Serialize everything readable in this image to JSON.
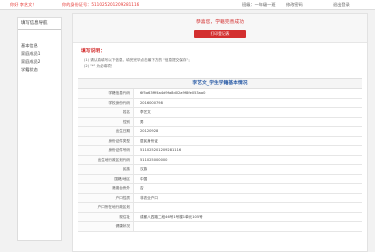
{
  "header": {
    "greeting": "你好 李艺文！",
    "id_label": "你的身份证号：",
    "id_number": "511025201209281116",
    "class_label": "班级：",
    "class_value": "一年级一班",
    "change_password": "修改密码",
    "logout": "退出登录"
  },
  "sidebar": {
    "title": "填写信息导航",
    "items": [
      {
        "label": "基本信息"
      },
      {
        "label": "家庭成员1"
      },
      {
        "label": "家庭成员2"
      },
      {
        "label": "学籍状态"
      }
    ]
  },
  "main": {
    "saved_message": "恭喜您，学籍完善成功",
    "print_button": "打印登记表",
    "notes_title": "填写说明：",
    "notes": [
      "(1) 请认真填写以下信息，填完完毕点击最下方的 \"信息提交保存\"；",
      "(2) \"*\" 为必填项！"
    ],
    "note_required_mark": "*",
    "table_title": "李艺文_学生学籍基本情况",
    "rows": [
      {
        "label": "学籍信息代码",
        "value": "6f5a63fff4a4d9fa8d02a9f8fe053aa0"
      },
      {
        "label": "学校身份代码",
        "value": "2016000798"
      },
      {
        "label": "姓名",
        "value": "李艺文"
      },
      {
        "label": "性别",
        "value": "男"
      },
      {
        "label": "出生日期",
        "value": "20120928"
      },
      {
        "label": "身份证件类型",
        "value": "居民身份证"
      },
      {
        "label": "身份证件号码",
        "value": "511025201209281116"
      },
      {
        "label": "出生地行政区划代码",
        "value": "511025000000"
      },
      {
        "label": "民族",
        "value": "汉族"
      },
      {
        "label": "国籍/地区",
        "value": "中国"
      },
      {
        "label": "港澳台侨外",
        "value": "否"
      },
      {
        "label": "户口性质",
        "value": "非农业户口"
      },
      {
        "label": "户口所在地行政区划",
        "value": ""
      },
      {
        "label": "现住址",
        "value": "成都八四路二段46号1号楼1单元105号"
      },
      {
        "label": "健康状况",
        "value": ""
      }
    ]
  }
}
